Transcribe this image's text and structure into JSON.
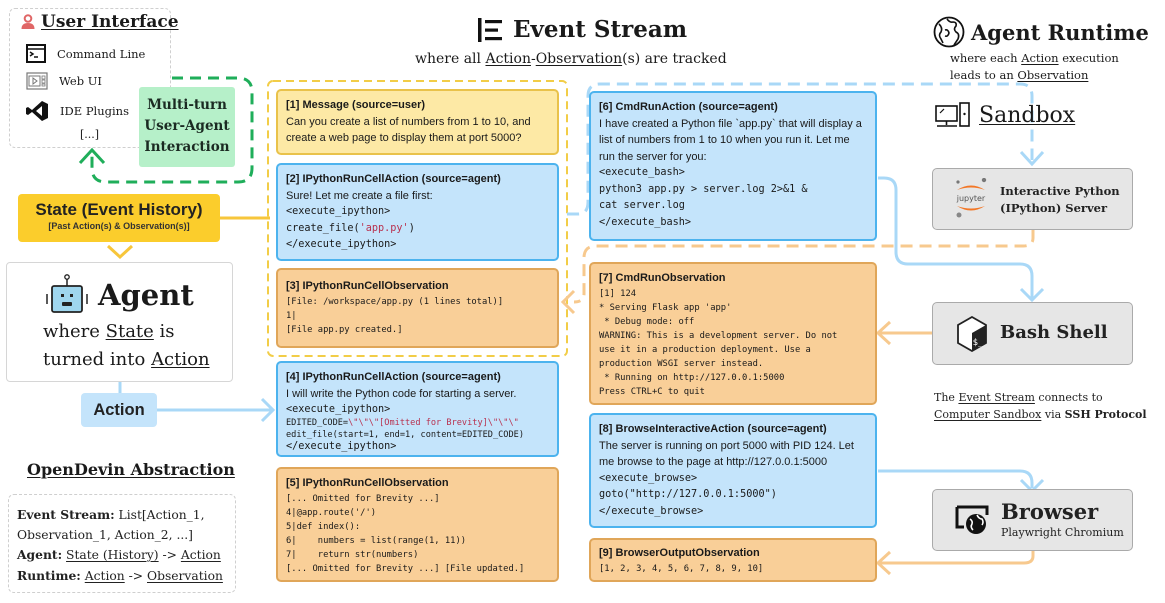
{
  "user_interface": {
    "title": "User Interface",
    "items": [
      {
        "icon": "terminal-icon",
        "label": "Command Line"
      },
      {
        "icon": "web-ui-icon",
        "label": "Web UI"
      },
      {
        "icon": "vscode-icon",
        "label": "IDE Plugins"
      }
    ],
    "more": "[...]"
  },
  "multi_turn": {
    "line1": "Multi-turn",
    "line2": "User-Agent",
    "line3": "Interaction"
  },
  "state": {
    "title": "State (Event History)",
    "subtitle": "[Past Action(s) & Observation(s)]"
  },
  "agent": {
    "title": "Agent",
    "desc_prefix": "where ",
    "desc_state": "State",
    "desc_mid": " is",
    "desc_line2_prefix": "turned into ",
    "desc_action": "Action"
  },
  "action_label": "Action",
  "abstraction": {
    "title": "OpenDevin Abstraction",
    "event_stream_label": "Event Stream:",
    "event_stream_value_1": " List[Action_1,",
    "event_stream_value_2": "Observation_1, Action_2, ...]",
    "agent_label": "Agent:",
    "agent_state": "State (History)",
    "arrow": " -> ",
    "agent_action": "Action",
    "runtime_label": "Runtime:",
    "runtime_action": "Action",
    "runtime_observation": "Observation"
  },
  "event_stream": {
    "title": "Event Stream",
    "sub_prefix": "where all ",
    "sub_action": "Action",
    "sub_dash": "-",
    "sub_observation": "Observation",
    "sub_suffix": "(s) are tracked",
    "events": [
      {
        "header": "[1] Message (source=user)",
        "text": "Can you create a list of numbers from 1 to 10, and create a web page to display them at port 5000?"
      },
      {
        "header": "[2] IPythonRunCellAction (source=agent)",
        "text": "Sure! Let me create a file first:",
        "code_open": "<execute_ipython>",
        "code_fn": "create_file(",
        "code_arg": "'app.py'",
        "code_close_paren": ")",
        "code_close": "</execute_ipython>"
      },
      {
        "header": "[3] IPythonRunCellObservation",
        "lines": [
          "[File: /workspace/app.py (1 lines total)]",
          "1|",
          "[File app.py created.]"
        ]
      },
      {
        "header": "[4] IPythonRunCellAction (source=agent)",
        "text": "I will write the Python code for starting a server.",
        "code_open": "<execute_ipython>",
        "code_edit_prefix": "EDITED_CODE=",
        "code_edit_str": "\\\"\\\"\\\"[Omitted for Brevity]\\\"\\\"\\\"",
        "code_edit_call": "edit_file(start=1, end=1, content=EDITED_CODE)",
        "code_close": "</execute_ipython>"
      },
      {
        "header": "[5] IPythonRunCellObservation",
        "lines": [
          "[... Omitted for Brevity ...]",
          "4|@app.route('/')",
          "5|def index():",
          "6|    numbers = list(range(1, 11))",
          "7|    return str(numbers)",
          "[... Omitted for Brevity ...] [File updated.]"
        ]
      },
      {
        "header": "[6] CmdRunAction (source=agent)",
        "text": "I have created a Python file `app.py` that will display a list of numbers from 1 to 10 when you run it. Let me run the server for you:",
        "code": [
          "<execute_bash>",
          "python3 app.py > server.log 2>&1 &",
          "cat server.log",
          "</execute_bash>"
        ]
      },
      {
        "header": "[7] CmdRunObservation",
        "lines": [
          "[1] 124",
          "* Serving Flask app 'app'",
          " * Debug mode: off",
          "WARNING: This is a development server. Do not",
          "use it in a production deployment. Use a",
          "production WSGI server instead.",
          " * Running on http://127.0.0.1:5000",
          "Press CTRL+C to quit"
        ]
      },
      {
        "header": "[8] BrowseInteractiveAction (source=agent)",
        "text": "The server is running on port 5000 with PID 124. Let me browse to the page at http://127.0.0.1:5000",
        "code": [
          "<execute_browse>",
          "goto(\"http://127.0.0.1:5000\")",
          "</execute_browse>"
        ]
      },
      {
        "header": "[9] BrowserOutputObservation",
        "lines": [
          "[1, 2, 3, 4, 5, 6, 7, 8, 9, 10]"
        ]
      }
    ]
  },
  "runtime": {
    "title": "Agent Runtime",
    "sub_prefix": "where each ",
    "sub_action": "Action",
    "sub_mid": " execution",
    "sub_line2_prefix": "leads to an ",
    "sub_observation": "Observation",
    "sandbox_title": "Sandbox",
    "ipython_line1": "Interactive Python",
    "ipython_line2": "(IPython) Server",
    "jupyter_label": "jupyter",
    "bash_title": "Bash Shell",
    "ssh_prefix": "The ",
    "ssh_event_stream": "Event Stream",
    "ssh_mid": " connects to",
    "ssh_sandbox": "Computer Sandbox",
    "ssh_via": " via ",
    "ssh_protocol": "SSH Protocol",
    "browser_title": "Browser",
    "browser_sub": "Playwright Chromium"
  },
  "colors": {
    "action_blue": "#c4e4fb",
    "action_border": "#4cb3ee",
    "observation_orange": "#f9cf98",
    "observation_border": "#e0a659",
    "message_yellow": "#fde9a5",
    "state_yellow": "#fbcd2c",
    "interaction_green": "#b6f0c9",
    "interaction_dash": "#1fae5a",
    "connector_blue": "#a9d8f7",
    "connector_orange": "#f7c98e"
  }
}
